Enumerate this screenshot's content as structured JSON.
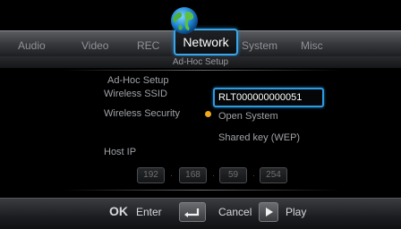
{
  "tabs": [
    "Audio",
    "Video",
    "REC",
    "Network",
    "System",
    "Misc"
  ],
  "active_tab": "Network",
  "subtitle": "Ad-Hoc Setup",
  "section_title": "Ad-Hoc Setup",
  "fields": {
    "ssid_label": "Wireless SSID",
    "ssid_value": "RLT000000000051",
    "security_label": "Wireless Security",
    "security_options": [
      "Open System",
      "Shared key (WEP)"
    ],
    "security_selected": "Open System",
    "host_ip_label": "Host IP",
    "host_ip": [
      "192",
      "168",
      "59",
      "254"
    ]
  },
  "footer": {
    "ok_key": "OK",
    "ok_label": "Enter",
    "cancel_label": "Cancel",
    "play_label": "Play"
  },
  "colors": {
    "accent_blue": "#2e9be0",
    "selected_dot": "#f0a91b"
  }
}
